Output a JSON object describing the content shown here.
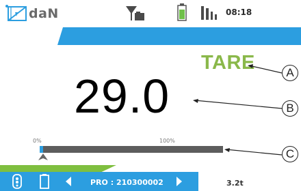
{
  "status_bar": {
    "brand": "daN",
    "time": "08:18",
    "icons": [
      "crane-logo-icon",
      "signal-icon",
      "battery-icon",
      "signal-bars-icon"
    ]
  },
  "main": {
    "tare_label": "TARE",
    "reading": "29.0",
    "progress": {
      "min_label": "0%",
      "max_label": "100%",
      "fill_fraction": 0.02
    }
  },
  "bottom_bar": {
    "pro_label": "PRO : 210300002",
    "capacity": "3.2t",
    "icons": [
      "bluetooth-device-icon",
      "small-battery-icon",
      "prev-icon",
      "next-icon"
    ]
  },
  "callouts": {
    "a": "A",
    "b": "B",
    "c": "C"
  },
  "colors": {
    "accent_blue": "#2c9ee0",
    "tare_green": "#8ab84a",
    "battery_green": "#6fc04a",
    "stripe_green": "#7fbf3f",
    "track_gray": "#5d5d5d"
  }
}
